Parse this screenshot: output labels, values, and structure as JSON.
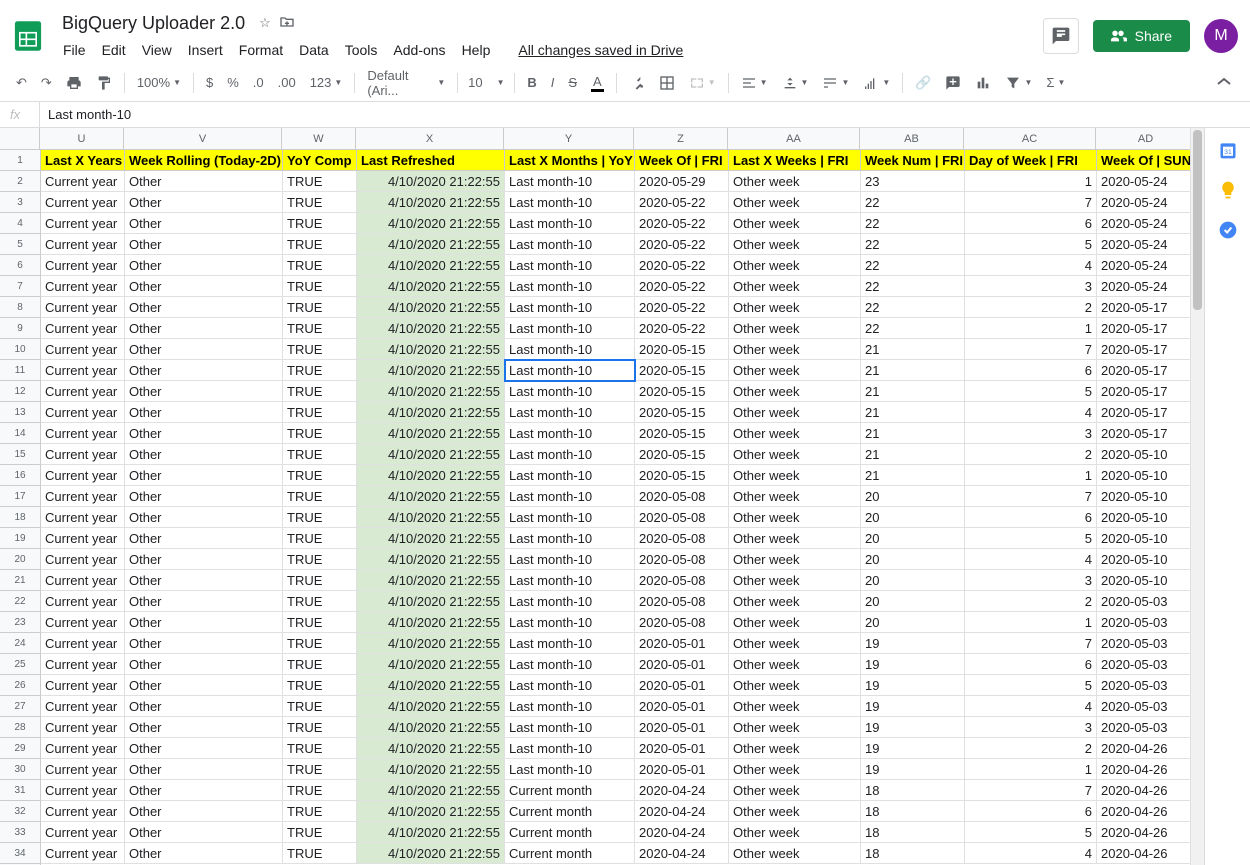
{
  "doc": {
    "title": "BigQuery Uploader 2.0"
  },
  "menus": [
    "File",
    "Edit",
    "View",
    "Insert",
    "Format",
    "Data",
    "Tools",
    "Add-ons",
    "Help"
  ],
  "saved_text": "All changes saved in Drive",
  "share_label": "Share",
  "avatar_letter": "M",
  "toolbar": {
    "zoom": "100%",
    "font": "Default (Ari...",
    "font_size": "10",
    "decimals_dec": ".0",
    "decimals_inc": ".00",
    "numfmt": "123"
  },
  "fx": {
    "value": "Last month-10"
  },
  "columns": [
    {
      "letter": "U",
      "label": "Last X Years",
      "cls": "w-u"
    },
    {
      "letter": "V",
      "label": "Week Rolling (Today-2D)",
      "cls": "w-v"
    },
    {
      "letter": "W",
      "label": "YoY Comp",
      "cls": "w-w"
    },
    {
      "letter": "X",
      "label": "Last Refreshed",
      "cls": "w-x"
    },
    {
      "letter": "Y",
      "label": "Last X Months | YoY",
      "cls": "w-y"
    },
    {
      "letter": "Z",
      "label": "Week Of | FRI",
      "cls": "w-z"
    },
    {
      "letter": "AA",
      "label": "Last X Weeks | FRI",
      "cls": "w-aa"
    },
    {
      "letter": "AB",
      "label": "Week Num | FRI",
      "cls": "w-ab"
    },
    {
      "letter": "AC",
      "label": "Day of Week | FRI",
      "cls": "w-ac"
    },
    {
      "letter": "AD",
      "label": "Week Of | SUN",
      "cls": "w-ad"
    }
  ],
  "selected": {
    "row": 11,
    "col": "Y"
  },
  "rows": [
    {
      "n": 2,
      "u": "Current year",
      "v": "Other",
      "w": "TRUE",
      "x": "4/10/2020 21:22:55",
      "y": "Last month-10",
      "z": "2020-05-29",
      "aa": "Other week",
      "ab": "23",
      "ac": "1",
      "ad": "2020-05-24"
    },
    {
      "n": 3,
      "u": "Current year",
      "v": "Other",
      "w": "TRUE",
      "x": "4/10/2020 21:22:55",
      "y": "Last month-10",
      "z": "2020-05-22",
      "aa": "Other week",
      "ab": "22",
      "ac": "7",
      "ad": "2020-05-24"
    },
    {
      "n": 4,
      "u": "Current year",
      "v": "Other",
      "w": "TRUE",
      "x": "4/10/2020 21:22:55",
      "y": "Last month-10",
      "z": "2020-05-22",
      "aa": "Other week",
      "ab": "22",
      "ac": "6",
      "ad": "2020-05-24"
    },
    {
      "n": 5,
      "u": "Current year",
      "v": "Other",
      "w": "TRUE",
      "x": "4/10/2020 21:22:55",
      "y": "Last month-10",
      "z": "2020-05-22",
      "aa": "Other week",
      "ab": "22",
      "ac": "5",
      "ad": "2020-05-24"
    },
    {
      "n": 6,
      "u": "Current year",
      "v": "Other",
      "w": "TRUE",
      "x": "4/10/2020 21:22:55",
      "y": "Last month-10",
      "z": "2020-05-22",
      "aa": "Other week",
      "ab": "22",
      "ac": "4",
      "ad": "2020-05-24"
    },
    {
      "n": 7,
      "u": "Current year",
      "v": "Other",
      "w": "TRUE",
      "x": "4/10/2020 21:22:55",
      "y": "Last month-10",
      "z": "2020-05-22",
      "aa": "Other week",
      "ab": "22",
      "ac": "3",
      "ad": "2020-05-24"
    },
    {
      "n": 8,
      "u": "Current year",
      "v": "Other",
      "w": "TRUE",
      "x": "4/10/2020 21:22:55",
      "y": "Last month-10",
      "z": "2020-05-22",
      "aa": "Other week",
      "ab": "22",
      "ac": "2",
      "ad": "2020-05-17"
    },
    {
      "n": 9,
      "u": "Current year",
      "v": "Other",
      "w": "TRUE",
      "x": "4/10/2020 21:22:55",
      "y": "Last month-10",
      "z": "2020-05-22",
      "aa": "Other week",
      "ab": "22",
      "ac": "1",
      "ad": "2020-05-17"
    },
    {
      "n": 10,
      "u": "Current year",
      "v": "Other",
      "w": "TRUE",
      "x": "4/10/2020 21:22:55",
      "y": "Last month-10",
      "z": "2020-05-15",
      "aa": "Other week",
      "ab": "21",
      "ac": "7",
      "ad": "2020-05-17"
    },
    {
      "n": 11,
      "u": "Current year",
      "v": "Other",
      "w": "TRUE",
      "x": "4/10/2020 21:22:55",
      "y": "Last month-10",
      "z": "2020-05-15",
      "aa": "Other week",
      "ab": "21",
      "ac": "6",
      "ad": "2020-05-17"
    },
    {
      "n": 12,
      "u": "Current year",
      "v": "Other",
      "w": "TRUE",
      "x": "4/10/2020 21:22:55",
      "y": "Last month-10",
      "z": "2020-05-15",
      "aa": "Other week",
      "ab": "21",
      "ac": "5",
      "ad": "2020-05-17"
    },
    {
      "n": 13,
      "u": "Current year",
      "v": "Other",
      "w": "TRUE",
      "x": "4/10/2020 21:22:55",
      "y": "Last month-10",
      "z": "2020-05-15",
      "aa": "Other week",
      "ab": "21",
      "ac": "4",
      "ad": "2020-05-17"
    },
    {
      "n": 14,
      "u": "Current year",
      "v": "Other",
      "w": "TRUE",
      "x": "4/10/2020 21:22:55",
      "y": "Last month-10",
      "z": "2020-05-15",
      "aa": "Other week",
      "ab": "21",
      "ac": "3",
      "ad": "2020-05-17"
    },
    {
      "n": 15,
      "u": "Current year",
      "v": "Other",
      "w": "TRUE",
      "x": "4/10/2020 21:22:55",
      "y": "Last month-10",
      "z": "2020-05-15",
      "aa": "Other week",
      "ab": "21",
      "ac": "2",
      "ad": "2020-05-10"
    },
    {
      "n": 16,
      "u": "Current year",
      "v": "Other",
      "w": "TRUE",
      "x": "4/10/2020 21:22:55",
      "y": "Last month-10",
      "z": "2020-05-15",
      "aa": "Other week",
      "ab": "21",
      "ac": "1",
      "ad": "2020-05-10"
    },
    {
      "n": 17,
      "u": "Current year",
      "v": "Other",
      "w": "TRUE",
      "x": "4/10/2020 21:22:55",
      "y": "Last month-10",
      "z": "2020-05-08",
      "aa": "Other week",
      "ab": "20",
      "ac": "7",
      "ad": "2020-05-10"
    },
    {
      "n": 18,
      "u": "Current year",
      "v": "Other",
      "w": "TRUE",
      "x": "4/10/2020 21:22:55",
      "y": "Last month-10",
      "z": "2020-05-08",
      "aa": "Other week",
      "ab": "20",
      "ac": "6",
      "ad": "2020-05-10"
    },
    {
      "n": 19,
      "u": "Current year",
      "v": "Other",
      "w": "TRUE",
      "x": "4/10/2020 21:22:55",
      "y": "Last month-10",
      "z": "2020-05-08",
      "aa": "Other week",
      "ab": "20",
      "ac": "5",
      "ad": "2020-05-10"
    },
    {
      "n": 20,
      "u": "Current year",
      "v": "Other",
      "w": "TRUE",
      "x": "4/10/2020 21:22:55",
      "y": "Last month-10",
      "z": "2020-05-08",
      "aa": "Other week",
      "ab": "20",
      "ac": "4",
      "ad": "2020-05-10"
    },
    {
      "n": 21,
      "u": "Current year",
      "v": "Other",
      "w": "TRUE",
      "x": "4/10/2020 21:22:55",
      "y": "Last month-10",
      "z": "2020-05-08",
      "aa": "Other week",
      "ab": "20",
      "ac": "3",
      "ad": "2020-05-10"
    },
    {
      "n": 22,
      "u": "Current year",
      "v": "Other",
      "w": "TRUE",
      "x": "4/10/2020 21:22:55",
      "y": "Last month-10",
      "z": "2020-05-08",
      "aa": "Other week",
      "ab": "20",
      "ac": "2",
      "ad": "2020-05-03"
    },
    {
      "n": 23,
      "u": "Current year",
      "v": "Other",
      "w": "TRUE",
      "x": "4/10/2020 21:22:55",
      "y": "Last month-10",
      "z": "2020-05-08",
      "aa": "Other week",
      "ab": "20",
      "ac": "1",
      "ad": "2020-05-03"
    },
    {
      "n": 24,
      "u": "Current year",
      "v": "Other",
      "w": "TRUE",
      "x": "4/10/2020 21:22:55",
      "y": "Last month-10",
      "z": "2020-05-01",
      "aa": "Other week",
      "ab": "19",
      "ac": "7",
      "ad": "2020-05-03"
    },
    {
      "n": 25,
      "u": "Current year",
      "v": "Other",
      "w": "TRUE",
      "x": "4/10/2020 21:22:55",
      "y": "Last month-10",
      "z": "2020-05-01",
      "aa": "Other week",
      "ab": "19",
      "ac": "6",
      "ad": "2020-05-03"
    },
    {
      "n": 26,
      "u": "Current year",
      "v": "Other",
      "w": "TRUE",
      "x": "4/10/2020 21:22:55",
      "y": "Last month-10",
      "z": "2020-05-01",
      "aa": "Other week",
      "ab": "19",
      "ac": "5",
      "ad": "2020-05-03"
    },
    {
      "n": 27,
      "u": "Current year",
      "v": "Other",
      "w": "TRUE",
      "x": "4/10/2020 21:22:55",
      "y": "Last month-10",
      "z": "2020-05-01",
      "aa": "Other week",
      "ab": "19",
      "ac": "4",
      "ad": "2020-05-03"
    },
    {
      "n": 28,
      "u": "Current year",
      "v": "Other",
      "w": "TRUE",
      "x": "4/10/2020 21:22:55",
      "y": "Last month-10",
      "z": "2020-05-01",
      "aa": "Other week",
      "ab": "19",
      "ac": "3",
      "ad": "2020-05-03"
    },
    {
      "n": 29,
      "u": "Current year",
      "v": "Other",
      "w": "TRUE",
      "x": "4/10/2020 21:22:55",
      "y": "Last month-10",
      "z": "2020-05-01",
      "aa": "Other week",
      "ab": "19",
      "ac": "2",
      "ad": "2020-04-26"
    },
    {
      "n": 30,
      "u": "Current year",
      "v": "Other",
      "w": "TRUE",
      "x": "4/10/2020 21:22:55",
      "y": "Last month-10",
      "z": "2020-05-01",
      "aa": "Other week",
      "ab": "19",
      "ac": "1",
      "ad": "2020-04-26"
    },
    {
      "n": 31,
      "u": "Current year",
      "v": "Other",
      "w": "TRUE",
      "x": "4/10/2020 21:22:55",
      "y": "Current month",
      "z": "2020-04-24",
      "aa": "Other week",
      "ab": "18",
      "ac": "7",
      "ad": "2020-04-26"
    },
    {
      "n": 32,
      "u": "Current year",
      "v": "Other",
      "w": "TRUE",
      "x": "4/10/2020 21:22:55",
      "y": "Current month",
      "z": "2020-04-24",
      "aa": "Other week",
      "ab": "18",
      "ac": "6",
      "ad": "2020-04-26"
    },
    {
      "n": 33,
      "u": "Current year",
      "v": "Other",
      "w": "TRUE",
      "x": "4/10/2020 21:22:55",
      "y": "Current month",
      "z": "2020-04-24",
      "aa": "Other week",
      "ab": "18",
      "ac": "5",
      "ad": "2020-04-26"
    },
    {
      "n": 34,
      "u": "Current year",
      "v": "Other",
      "w": "TRUE",
      "x": "4/10/2020 21:22:55",
      "y": "Current month",
      "z": "2020-04-24",
      "aa": "Other week",
      "ab": "18",
      "ac": "4",
      "ad": "2020-04-26"
    }
  ]
}
